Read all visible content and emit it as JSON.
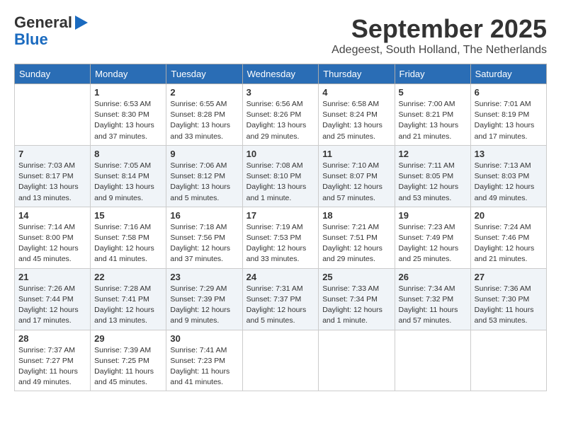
{
  "logo": {
    "line1": "General",
    "line2": "Blue"
  },
  "title": "September 2025",
  "location": "Adegeest, South Holland, The Netherlands",
  "days_of_week": [
    "Sunday",
    "Monday",
    "Tuesday",
    "Wednesday",
    "Thursday",
    "Friday",
    "Saturday"
  ],
  "weeks": [
    [
      {
        "day": "",
        "info": ""
      },
      {
        "day": "1",
        "info": "Sunrise: 6:53 AM\nSunset: 8:30 PM\nDaylight: 13 hours\nand 37 minutes."
      },
      {
        "day": "2",
        "info": "Sunrise: 6:55 AM\nSunset: 8:28 PM\nDaylight: 13 hours\nand 33 minutes."
      },
      {
        "day": "3",
        "info": "Sunrise: 6:56 AM\nSunset: 8:26 PM\nDaylight: 13 hours\nand 29 minutes."
      },
      {
        "day": "4",
        "info": "Sunrise: 6:58 AM\nSunset: 8:24 PM\nDaylight: 13 hours\nand 25 minutes."
      },
      {
        "day": "5",
        "info": "Sunrise: 7:00 AM\nSunset: 8:21 PM\nDaylight: 13 hours\nand 21 minutes."
      },
      {
        "day": "6",
        "info": "Sunrise: 7:01 AM\nSunset: 8:19 PM\nDaylight: 13 hours\nand 17 minutes."
      }
    ],
    [
      {
        "day": "7",
        "info": "Sunrise: 7:03 AM\nSunset: 8:17 PM\nDaylight: 13 hours\nand 13 minutes."
      },
      {
        "day": "8",
        "info": "Sunrise: 7:05 AM\nSunset: 8:14 PM\nDaylight: 13 hours\nand 9 minutes."
      },
      {
        "day": "9",
        "info": "Sunrise: 7:06 AM\nSunset: 8:12 PM\nDaylight: 13 hours\nand 5 minutes."
      },
      {
        "day": "10",
        "info": "Sunrise: 7:08 AM\nSunset: 8:10 PM\nDaylight: 13 hours\nand 1 minute."
      },
      {
        "day": "11",
        "info": "Sunrise: 7:10 AM\nSunset: 8:07 PM\nDaylight: 12 hours\nand 57 minutes."
      },
      {
        "day": "12",
        "info": "Sunrise: 7:11 AM\nSunset: 8:05 PM\nDaylight: 12 hours\nand 53 minutes."
      },
      {
        "day": "13",
        "info": "Sunrise: 7:13 AM\nSunset: 8:03 PM\nDaylight: 12 hours\nand 49 minutes."
      }
    ],
    [
      {
        "day": "14",
        "info": "Sunrise: 7:14 AM\nSunset: 8:00 PM\nDaylight: 12 hours\nand 45 minutes."
      },
      {
        "day": "15",
        "info": "Sunrise: 7:16 AM\nSunset: 7:58 PM\nDaylight: 12 hours\nand 41 minutes."
      },
      {
        "day": "16",
        "info": "Sunrise: 7:18 AM\nSunset: 7:56 PM\nDaylight: 12 hours\nand 37 minutes."
      },
      {
        "day": "17",
        "info": "Sunrise: 7:19 AM\nSunset: 7:53 PM\nDaylight: 12 hours\nand 33 minutes."
      },
      {
        "day": "18",
        "info": "Sunrise: 7:21 AM\nSunset: 7:51 PM\nDaylight: 12 hours\nand 29 minutes."
      },
      {
        "day": "19",
        "info": "Sunrise: 7:23 AM\nSunset: 7:49 PM\nDaylight: 12 hours\nand 25 minutes."
      },
      {
        "day": "20",
        "info": "Sunrise: 7:24 AM\nSunset: 7:46 PM\nDaylight: 12 hours\nand 21 minutes."
      }
    ],
    [
      {
        "day": "21",
        "info": "Sunrise: 7:26 AM\nSunset: 7:44 PM\nDaylight: 12 hours\nand 17 minutes."
      },
      {
        "day": "22",
        "info": "Sunrise: 7:28 AM\nSunset: 7:41 PM\nDaylight: 12 hours\nand 13 minutes."
      },
      {
        "day": "23",
        "info": "Sunrise: 7:29 AM\nSunset: 7:39 PM\nDaylight: 12 hours\nand 9 minutes."
      },
      {
        "day": "24",
        "info": "Sunrise: 7:31 AM\nSunset: 7:37 PM\nDaylight: 12 hours\nand 5 minutes."
      },
      {
        "day": "25",
        "info": "Sunrise: 7:33 AM\nSunset: 7:34 PM\nDaylight: 12 hours\nand 1 minute."
      },
      {
        "day": "26",
        "info": "Sunrise: 7:34 AM\nSunset: 7:32 PM\nDaylight: 11 hours\nand 57 minutes."
      },
      {
        "day": "27",
        "info": "Sunrise: 7:36 AM\nSunset: 7:30 PM\nDaylight: 11 hours\nand 53 minutes."
      }
    ],
    [
      {
        "day": "28",
        "info": "Sunrise: 7:37 AM\nSunset: 7:27 PM\nDaylight: 11 hours\nand 49 minutes."
      },
      {
        "day": "29",
        "info": "Sunrise: 7:39 AM\nSunset: 7:25 PM\nDaylight: 11 hours\nand 45 minutes."
      },
      {
        "day": "30",
        "info": "Sunrise: 7:41 AM\nSunset: 7:23 PM\nDaylight: 11 hours\nand 41 minutes."
      },
      {
        "day": "",
        "info": ""
      },
      {
        "day": "",
        "info": ""
      },
      {
        "day": "",
        "info": ""
      },
      {
        "day": "",
        "info": ""
      }
    ]
  ]
}
